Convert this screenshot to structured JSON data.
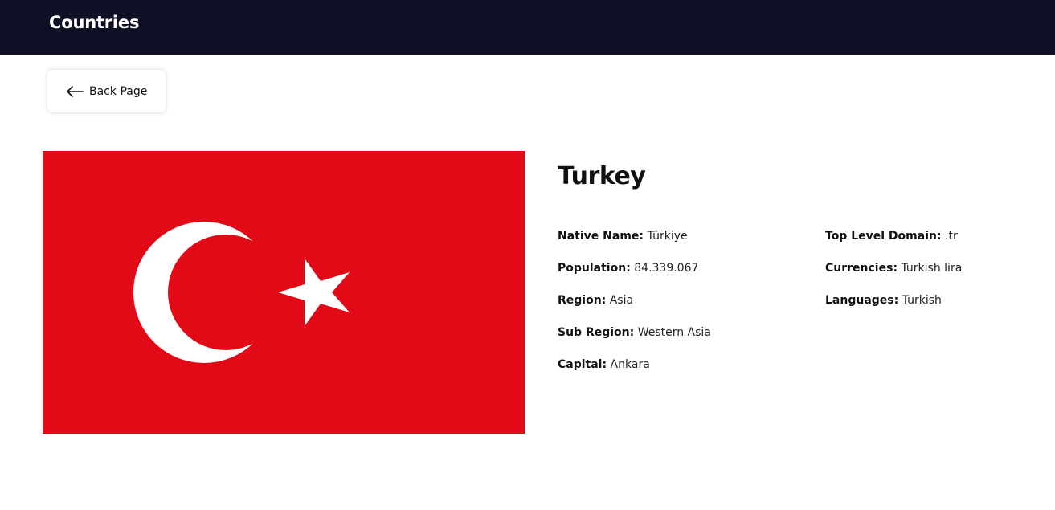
{
  "header": {
    "title": "Countries"
  },
  "back_button": {
    "label": "Back Page",
    "icon": "arrow-left-icon"
  },
  "flag": {
    "alt": "Turkey flag",
    "colors": {
      "red": "#e30a17",
      "white": "#ffffff"
    }
  },
  "country": {
    "name": "Turkey",
    "left_details": [
      {
        "label": "Native Name:",
        "value": "Türkiye"
      },
      {
        "label": "Population:",
        "value": "84.339.067"
      },
      {
        "label": "Region:",
        "value": "Asia"
      },
      {
        "label": "Sub Region:",
        "value": "Western Asia"
      },
      {
        "label": "Capital:",
        "value": "Ankara"
      }
    ],
    "right_details": [
      {
        "label": "Top Level Domain:",
        "value": ".tr"
      },
      {
        "label": "Currencies:",
        "value": "Turkish lira"
      },
      {
        "label": "Languages:",
        "value": "Turkish"
      }
    ]
  },
  "colors": {
    "header_bg": "#0f0f25",
    "background": "#ffffff"
  }
}
